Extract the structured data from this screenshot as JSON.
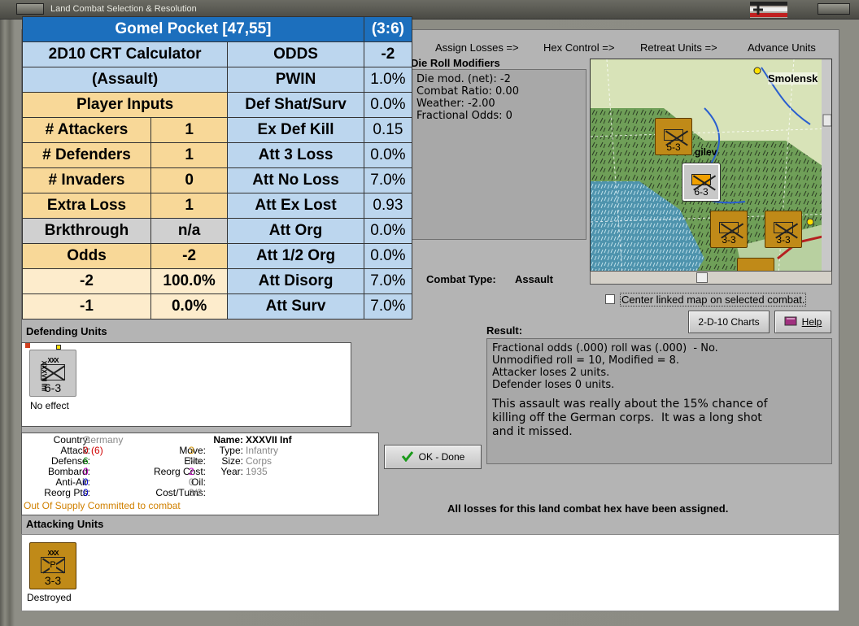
{
  "window": {
    "title": "Land Combat Selection & Resolution"
  },
  "steps": [
    "Assign Losses =>",
    "Hex Control =>",
    "Retreat Units =>",
    "Advance Units"
  ],
  "modifiers": {
    "title": "Die Roll Modifiers",
    "lines": [
      "Die mod. (net): -2",
      "",
      "Combat Ratio: 0.00",
      "Weather: -2.00",
      "Fractional Odds: 0"
    ]
  },
  "map": {
    "city": "Smolensk",
    "town": "gilev",
    "checkbox_label": "Center linked map on selected combat."
  },
  "combat_type": {
    "label": "Combat Type:",
    "value": "Assault"
  },
  "buttons": {
    "charts": "2-D-10 Charts",
    "help": "Help",
    "ok": "OK - Done"
  },
  "result": {
    "title": "Result:",
    "lines": [
      "Fractional odds (.000) roll was (.000)  - No.",
      "Unmodified roll = 10, Modified = 8.",
      "Attacker loses 2 units.",
      "Defender loses 0 units."
    ],
    "comment": "This assault was really about the 15% chance of\nkilling off the German corps.  It was a long shot\nand it missed."
  },
  "defending": {
    "title": "Defending Units",
    "unit": {
      "size": "XXX",
      "label": "XXXVII Inf",
      "strength": "6-3",
      "status": "No effect"
    }
  },
  "attacking": {
    "title": "Attacking Units",
    "unit": {
      "size": "XXX",
      "letter": "P",
      "strength": "3-3",
      "status": "Destroyed"
    }
  },
  "unit_info": {
    "country_label": "Country:",
    "country": "Germany",
    "attack_label": "Attack:",
    "attack": "0",
    "attack_base": "(6)",
    "defense_label": "Defense:",
    "defense": "6",
    "bombard_label": "Bombard:",
    "bombard": "0",
    "antiair_label": "Anti-Air:",
    "antiair": "0",
    "reorg_label": "Reorg Pts:",
    "reorg": "0",
    "move_label": "Move:",
    "move": "3",
    "elite_label": "Elite:",
    "elite": "No",
    "reorg_cost_label": "Reorg Cost:",
    "reorg_cost": "2",
    "oil_label": "Oil:",
    "oil": "0",
    "cost_label": "Cost/Turns:",
    "cost": "3/2",
    "name_label": "Name:",
    "name": "XXXVII Inf",
    "type_label": "Type:",
    "type": "Infantry",
    "size_label": "Size:",
    "size": "Corps",
    "year_label": "Year:",
    "year": "1935",
    "supply": "Out Of Supply",
    "committed": "Committed to combat"
  },
  "footer_msg": "All losses for this land combat hex have been assigned.",
  "crt": {
    "title": "Gomel Pocket [47,55]",
    "turn": "(3:6)",
    "calc": "2D10 CRT Calculator",
    "mode": "(Assault)",
    "inputs": "Player Inputs",
    "rows": [
      {
        "k": "# Attackers",
        "v": "1"
      },
      {
        "k": "# Defenders",
        "v": "1"
      },
      {
        "k": "# Invaders",
        "v": "0"
      },
      {
        "k": "Extra Loss",
        "v": "1"
      },
      {
        "k": "Brkthrough",
        "v": "n/a"
      },
      {
        "k": "Odds",
        "v": "-2"
      },
      {
        "k": "-2",
        "v": "100.0%"
      },
      {
        "k": "-1",
        "v": "0.0%"
      }
    ],
    "right": [
      {
        "k": "ODDS",
        "v": "-2"
      },
      {
        "k": "PWIN",
        "v": "1.0%"
      },
      {
        "k": "Def Shat/Surv",
        "v": "0.0%"
      },
      {
        "k": "Ex Def Kill",
        "v": "0.15"
      },
      {
        "k": "Att 3 Loss",
        "v": "0.0%"
      },
      {
        "k": "Att No Loss",
        "v": "7.0%"
      },
      {
        "k": "Att Ex Lost",
        "v": "0.93"
      },
      {
        "k": "Att Org",
        "v": "0.0%"
      },
      {
        "k": "Att 1/2 Org",
        "v": "0.0%"
      },
      {
        "k": "Att Disorg",
        "v": "7.0%"
      },
      {
        "k": "Att Surv",
        "v": "7.0%"
      }
    ]
  }
}
